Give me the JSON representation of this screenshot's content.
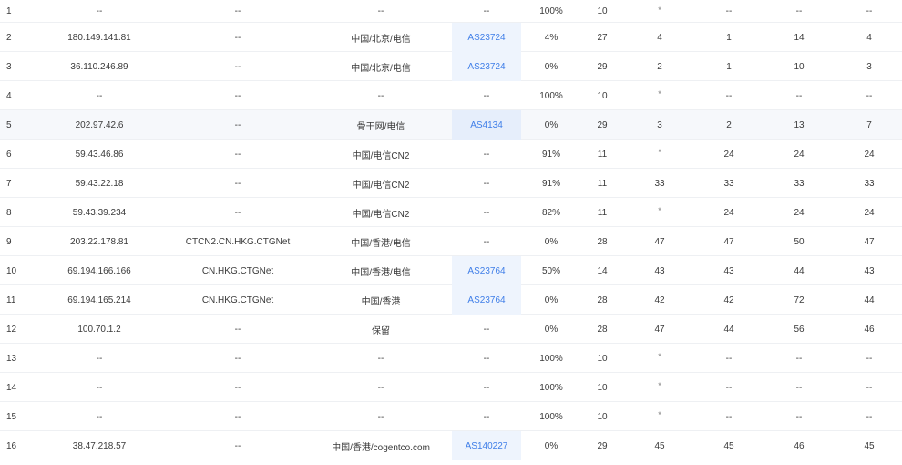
{
  "trace": {
    "rows": [
      {
        "hop": "1",
        "ip": "--",
        "host": "--",
        "location": "--",
        "as": "--",
        "loss": "100%",
        "sent": "10",
        "last": "*",
        "best": "--",
        "worst": "--",
        "avg": "--"
      },
      {
        "hop": "2",
        "ip": "180.149.141.81",
        "host": "--",
        "location": "中国/北京/电信",
        "as": "AS23724",
        "loss": "4%",
        "sent": "27",
        "last": "4",
        "best": "1",
        "worst": "14",
        "avg": "4"
      },
      {
        "hop": "3",
        "ip": "36.110.246.89",
        "host": "--",
        "location": "中国/北京/电信",
        "as": "AS23724",
        "loss": "0%",
        "sent": "29",
        "last": "2",
        "best": "1",
        "worst": "10",
        "avg": "3"
      },
      {
        "hop": "4",
        "ip": "--",
        "host": "--",
        "location": "--",
        "as": "--",
        "loss": "100%",
        "sent": "10",
        "last": "*",
        "best": "--",
        "worst": "--",
        "avg": "--"
      },
      {
        "hop": "5",
        "ip": "202.97.42.6",
        "host": "--",
        "location": "骨干网/电信",
        "as": "AS4134",
        "loss": "0%",
        "sent": "29",
        "last": "3",
        "best": "2",
        "worst": "13",
        "avg": "7"
      },
      {
        "hop": "6",
        "ip": "59.43.46.86",
        "host": "--",
        "location": "中国/电信CN2",
        "as": "--",
        "loss": "91%",
        "sent": "11",
        "last": "*",
        "best": "24",
        "worst": "24",
        "avg": "24"
      },
      {
        "hop": "7",
        "ip": "59.43.22.18",
        "host": "--",
        "location": "中国/电信CN2",
        "as": "--",
        "loss": "91%",
        "sent": "11",
        "last": "33",
        "best": "33",
        "worst": "33",
        "avg": "33"
      },
      {
        "hop": "8",
        "ip": "59.43.39.234",
        "host": "--",
        "location": "中国/电信CN2",
        "as": "--",
        "loss": "82%",
        "sent": "11",
        "last": "*",
        "best": "24",
        "worst": "24",
        "avg": "24"
      },
      {
        "hop": "9",
        "ip": "203.22.178.81",
        "host": "CTCN2.CN.HKG.CTGNet",
        "location": "中国/香港/电信",
        "as": "--",
        "loss": "0%",
        "sent": "28",
        "last": "47",
        "best": "47",
        "worst": "50",
        "avg": "47"
      },
      {
        "hop": "10",
        "ip": "69.194.166.166",
        "host": "CN.HKG.CTGNet",
        "location": "中国/香港/电信",
        "as": "AS23764",
        "loss": "50%",
        "sent": "14",
        "last": "43",
        "best": "43",
        "worst": "44",
        "avg": "43"
      },
      {
        "hop": "11",
        "ip": "69.194.165.214",
        "host": "CN.HKG.CTGNet",
        "location": "中国/香港",
        "as": "AS23764",
        "loss": "0%",
        "sent": "28",
        "last": "42",
        "best": "42",
        "worst": "72",
        "avg": "44"
      },
      {
        "hop": "12",
        "ip": "100.70.1.2",
        "host": "--",
        "location": "保留",
        "as": "--",
        "loss": "0%",
        "sent": "28",
        "last": "47",
        "best": "44",
        "worst": "56",
        "avg": "46"
      },
      {
        "hop": "13",
        "ip": "--",
        "host": "--",
        "location": "--",
        "as": "--",
        "loss": "100%",
        "sent": "10",
        "last": "*",
        "best": "--",
        "worst": "--",
        "avg": "--"
      },
      {
        "hop": "14",
        "ip": "--",
        "host": "--",
        "location": "--",
        "as": "--",
        "loss": "100%",
        "sent": "10",
        "last": "*",
        "best": "--",
        "worst": "--",
        "avg": "--"
      },
      {
        "hop": "15",
        "ip": "--",
        "host": "--",
        "location": "--",
        "as": "--",
        "loss": "100%",
        "sent": "10",
        "last": "*",
        "best": "--",
        "worst": "--",
        "avg": "--"
      },
      {
        "hop": "16",
        "ip": "38.47.218.57",
        "host": "--",
        "location": "中国/香港/cogentco.com",
        "as": "AS140227",
        "loss": "0%",
        "sent": "29",
        "last": "45",
        "best": "45",
        "worst": "46",
        "avg": "45"
      }
    ]
  },
  "colors": {
    "as_link": "#3f7ee8",
    "row_border": "#eef0f3",
    "row_shade": "#f6f8fb",
    "text": "#3a3a3a"
  }
}
